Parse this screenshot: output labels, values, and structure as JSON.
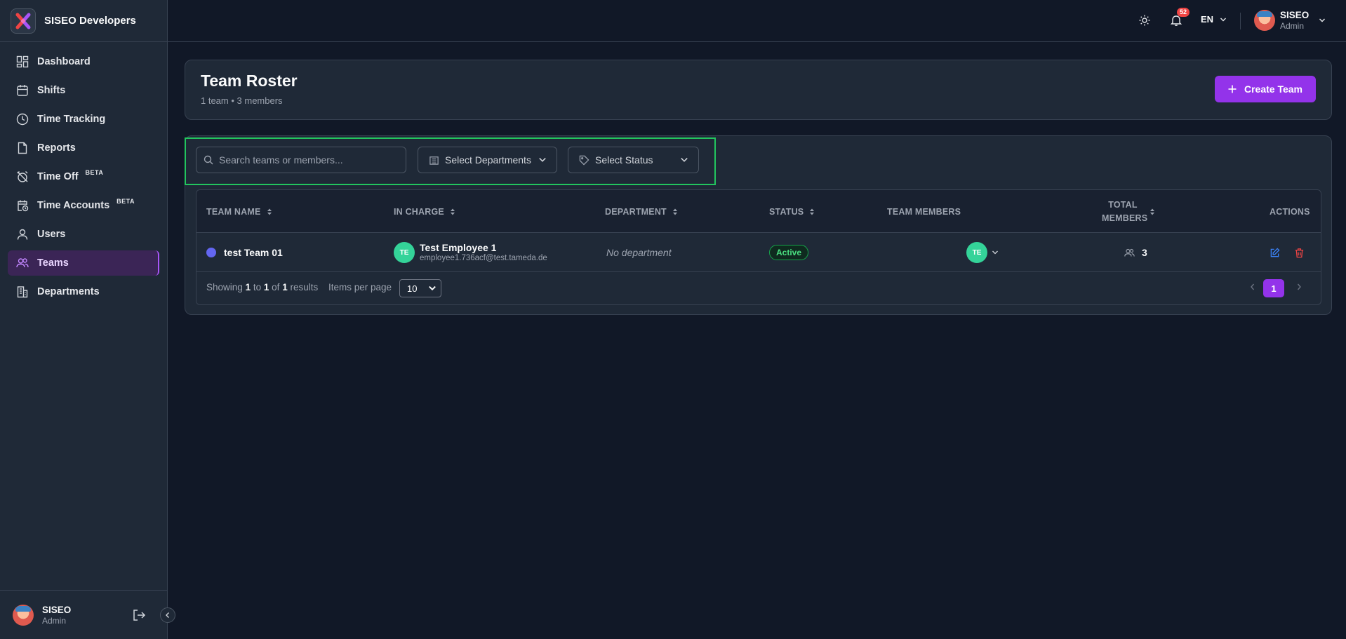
{
  "brand": {
    "name": "SISEO Developers"
  },
  "sidebar": {
    "items": [
      {
        "label": "Dashboard",
        "icon": "dashboard-icon"
      },
      {
        "label": "Shifts",
        "icon": "calendar-icon"
      },
      {
        "label": "Time Tracking",
        "icon": "clock-icon"
      },
      {
        "label": "Reports",
        "icon": "file-icon"
      },
      {
        "label": "Time Off",
        "icon": "alarm-off-icon",
        "badge": "BETA"
      },
      {
        "label": "Time Accounts",
        "icon": "calendar-clock-icon",
        "badge": "BETA"
      },
      {
        "label": "Users",
        "icon": "user-icon"
      },
      {
        "label": "Teams",
        "icon": "users-icon",
        "active": true
      },
      {
        "label": "Departments",
        "icon": "building-icon"
      }
    ],
    "footer": {
      "name": "SISEO",
      "role": "Admin"
    }
  },
  "header": {
    "notifications": "52",
    "language": "EN",
    "user": {
      "name": "SISEO",
      "role": "Admin"
    }
  },
  "page": {
    "title": "Team Roster",
    "subtitle": "1 team • 3 members",
    "create_button": "Create Team"
  },
  "filters": {
    "search_placeholder": "Search teams or members...",
    "departments_label": "Select Departments",
    "status_label": "Select Status"
  },
  "table": {
    "columns": [
      "TEAM NAME",
      "IN CHARGE",
      "DEPARTMENT",
      "STATUS",
      "TEAM MEMBERS",
      "TOTAL MEMBERS",
      "ACTIONS"
    ],
    "rows": [
      {
        "team_name": "test Team 01",
        "in_charge_initials": "TE",
        "in_charge_name": "Test Employee 1",
        "in_charge_email": "employee1.736acf@test.tameda.de",
        "department": "No department",
        "status": "Active",
        "members_initials": "TE",
        "total_members": "3"
      }
    ]
  },
  "footer": {
    "showing_prefix": "Showing",
    "from": "1",
    "to_word": "to",
    "to": "1",
    "of_word": "of",
    "total": "1",
    "results_word": "results",
    "items_per_page_label": "Items per page",
    "items_per_page": "10",
    "current_page": "1"
  },
  "colors": {
    "accent": "#9333ea",
    "highlight": "#22c55e",
    "team_dot": "#6366f1",
    "status_active": "#4ade80"
  }
}
